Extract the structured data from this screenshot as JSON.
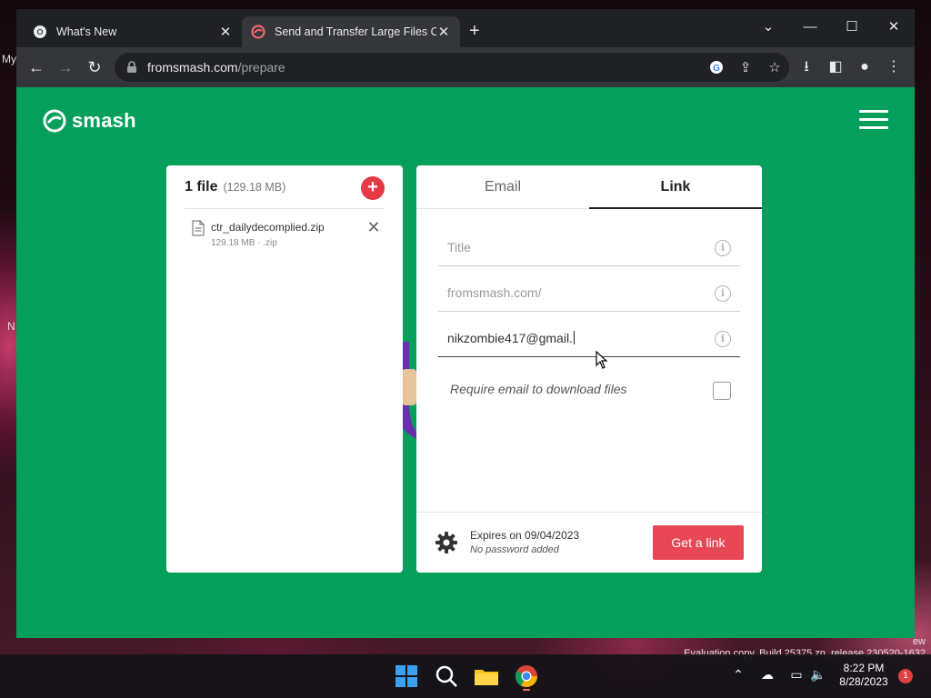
{
  "desktop": {
    "fragments": [
      "My",
      "N"
    ],
    "watermark_line1": "ew",
    "watermark_line2": "Evaluation copy. Build 25375.zn_release.230520-1632"
  },
  "browser": {
    "tabs": [
      {
        "title": "What's New",
        "icon": "chrome-icon",
        "active": false
      },
      {
        "title": "Send and Transfer Large Files Online",
        "icon": "smash-icon",
        "active": true
      }
    ],
    "url_host": "fromsmash.com",
    "url_path": "/prepare"
  },
  "page": {
    "brand": "smash",
    "files": {
      "count_label": "1 file",
      "total_size": "(129.18 MB)",
      "items": [
        {
          "name": "ctr_dailydecomplied.zip",
          "meta": "129.18 MB · .zip"
        }
      ]
    },
    "share": {
      "tabs": [
        "Email",
        "Link"
      ],
      "active_tab": "Link",
      "title_placeholder": "Title",
      "url_placeholder": "fromsmash.com/",
      "email_value": "nikzombie417@gmail.",
      "require_email_label": "Require email to download files",
      "require_email_checked": false,
      "expires_label": "Expires on 09/04/2023",
      "password_label": "No password added",
      "get_link_label": "Get a link"
    }
  },
  "taskbar": {
    "time": "8:22 PM",
    "date": "8/28/2023",
    "notification_count": "1"
  },
  "colors": {
    "page_bg": "#04a05b",
    "accent_red": "#e84855",
    "chrome_dark": "#202124"
  }
}
